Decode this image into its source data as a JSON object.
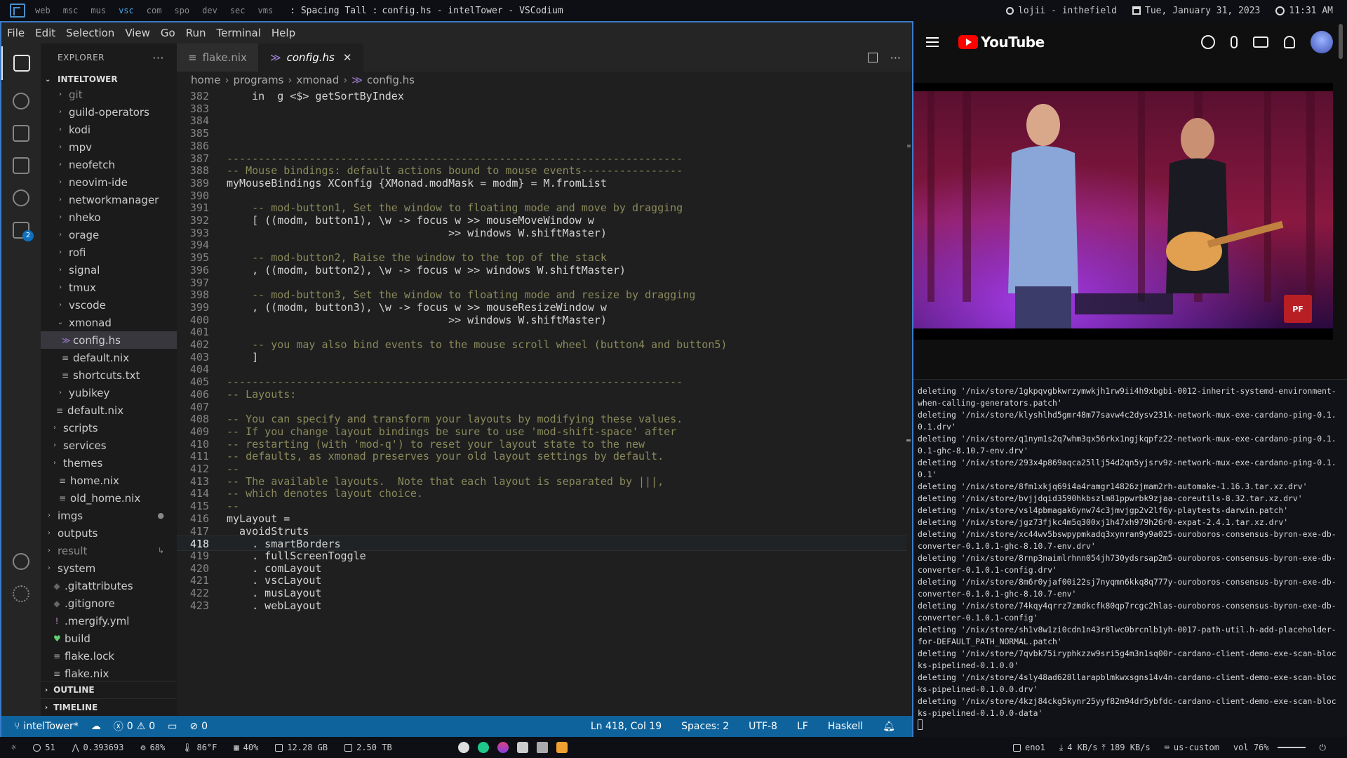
{
  "topbar": {
    "workspaces": [
      "web",
      "msc",
      "mus",
      "vsc",
      "com",
      "spo",
      "dev",
      "sec",
      "vms"
    ],
    "active_workspace": "vsc",
    "layout_name": "Spacing Tall",
    "window_title": "config.hs - intelTower - VSCodium",
    "user": "lojii - inthefield",
    "date": "Tue, January 31, 2023",
    "time": "11:31 AM"
  },
  "vscode": {
    "menu": [
      "File",
      "Edit",
      "Selection",
      "View",
      "Go",
      "Run",
      "Terminal",
      "Help"
    ],
    "explorer_title": "EXPLORER",
    "explorer_more": "···",
    "root": "INTELTOWER",
    "tree": [
      {
        "label": "git",
        "indent": 1,
        "kind": "folder",
        "dim": true
      },
      {
        "label": "guild-operators",
        "indent": 1,
        "kind": "folder"
      },
      {
        "label": "kodi",
        "indent": 1,
        "kind": "folder"
      },
      {
        "label": "mpv",
        "indent": 1,
        "kind": "folder"
      },
      {
        "label": "neofetch",
        "indent": 1,
        "kind": "folder"
      },
      {
        "label": "neovim-ide",
        "indent": 1,
        "kind": "folder"
      },
      {
        "label": "networkmanager",
        "indent": 1,
        "kind": "folder"
      },
      {
        "label": "nheko",
        "indent": 1,
        "kind": "folder"
      },
      {
        "label": "orage",
        "indent": 1,
        "kind": "folder"
      },
      {
        "label": "rofi",
        "indent": 1,
        "kind": "folder"
      },
      {
        "label": "signal",
        "indent": 1,
        "kind": "folder"
      },
      {
        "label": "tmux",
        "indent": 1,
        "kind": "folder"
      },
      {
        "label": "vscode",
        "indent": 1,
        "kind": "folder"
      },
      {
        "label": "xmonad",
        "indent": 1,
        "kind": "folder-open"
      },
      {
        "label": "config.hs",
        "indent": 2,
        "kind": "haskell",
        "selected": true
      },
      {
        "label": "default.nix",
        "indent": 2,
        "kind": "file"
      },
      {
        "label": "shortcuts.txt",
        "indent": 2,
        "kind": "file"
      },
      {
        "label": "yubikey",
        "indent": 1,
        "kind": "folder"
      },
      {
        "label": "default.nix",
        "indent": 1,
        "kind": "file"
      },
      {
        "label": "scripts",
        "indent": 0,
        "kind": "folder"
      },
      {
        "label": "services",
        "indent": 0,
        "kind": "folder"
      },
      {
        "label": "themes",
        "indent": 0,
        "kind": "folder"
      },
      {
        "label": "home.nix",
        "indent": 0,
        "kind": "file"
      },
      {
        "label": "old_home.nix",
        "indent": 0,
        "kind": "file"
      },
      {
        "label": "imgs",
        "indent": -1,
        "kind": "folder",
        "mark": "●"
      },
      {
        "label": "outputs",
        "indent": -1,
        "kind": "folder"
      },
      {
        "label": "result",
        "indent": -1,
        "kind": "folder",
        "dim": true,
        "mark": "↳"
      },
      {
        "label": "system",
        "indent": -1,
        "kind": "folder"
      },
      {
        "label": ".gitattributes",
        "indent": -1,
        "kind": "git"
      },
      {
        "label": ".gitignore",
        "indent": -1,
        "kind": "git"
      },
      {
        "label": ".mergify.yml",
        "indent": -1,
        "kind": "yml"
      },
      {
        "label": "build",
        "indent": -1,
        "kind": "heart"
      },
      {
        "label": "flake.lock",
        "indent": -1,
        "kind": "file"
      },
      {
        "label": "flake.nix",
        "indent": -1,
        "kind": "file"
      }
    ],
    "outline_label": "OUTLINE",
    "timeline_label": "TIMELINE",
    "tabs": [
      {
        "label": "flake.nix",
        "icon": "≡",
        "active": false
      },
      {
        "label": "config.hs",
        "icon": "≫",
        "active": true,
        "close": "✕"
      }
    ],
    "breadcrumb": [
      "home",
      "programs",
      "xmonad",
      "config.hs"
    ],
    "code_lines": [
      {
        "n": "382",
        "t": "    in  g <$> getSortByIndex"
      },
      {
        "n": "383",
        "t": ""
      },
      {
        "n": "384",
        "t": ""
      },
      {
        "n": "385",
        "t": ""
      },
      {
        "n": "386",
        "t": ""
      },
      {
        "n": "387",
        "t": "------------------------------------------------------------------------",
        "c": true
      },
      {
        "n": "388",
        "t": "-- Mouse bindings: default actions bound to mouse events----------------",
        "c": true
      },
      {
        "n": "389",
        "t": "myMouseBindings XConfig {XMonad.modMask = modm} = M.fromList"
      },
      {
        "n": "390",
        "t": ""
      },
      {
        "n": "391",
        "t": "    -- mod-button1, Set the window to floating mode and move by dragging",
        "c": true
      },
      {
        "n": "392",
        "t": "    [ ((modm, button1), \\w -> focus w >> mouseMoveWindow w"
      },
      {
        "n": "393",
        "t": "                                   >> windows W.shiftMaster)"
      },
      {
        "n": "394",
        "t": ""
      },
      {
        "n": "395",
        "t": "    -- mod-button2, Raise the window to the top of the stack",
        "c": true
      },
      {
        "n": "396",
        "t": "    , ((modm, button2), \\w -> focus w >> windows W.shiftMaster)"
      },
      {
        "n": "397",
        "t": ""
      },
      {
        "n": "398",
        "t": "    -- mod-button3, Set the window to floating mode and resize by dragging",
        "c": true
      },
      {
        "n": "399",
        "t": "    , ((modm, button3), \\w -> focus w >> mouseResizeWindow w"
      },
      {
        "n": "400",
        "t": "                                   >> windows W.shiftMaster)"
      },
      {
        "n": "401",
        "t": ""
      },
      {
        "n": "402",
        "t": "    -- you may also bind events to the mouse scroll wheel (button4 and button5)",
        "c": true
      },
      {
        "n": "403",
        "t": "    ]"
      },
      {
        "n": "404",
        "t": ""
      },
      {
        "n": "405",
        "t": "------------------------------------------------------------------------",
        "c": true
      },
      {
        "n": "406",
        "t": "-- Layouts:",
        "c": true
      },
      {
        "n": "407",
        "t": ""
      },
      {
        "n": "408",
        "t": "-- You can specify and transform your layouts by modifying these values.",
        "c": true
      },
      {
        "n": "409",
        "t": "-- If you change layout bindings be sure to use 'mod-shift-space' after",
        "c": true
      },
      {
        "n": "410",
        "t": "-- restarting (with 'mod-q') to reset your layout state to the new",
        "c": true
      },
      {
        "n": "411",
        "t": "-- defaults, as xmonad preserves your old layout settings by default.",
        "c": true
      },
      {
        "n": "412",
        "t": "--",
        "c": true
      },
      {
        "n": "413",
        "t": "-- The available layouts.  Note that each layout is separated by |||,",
        "c": true
      },
      {
        "n": "414",
        "t": "-- which denotes layout choice.",
        "c": true
      },
      {
        "n": "415",
        "t": "--",
        "c": true
      },
      {
        "n": "416",
        "t": "myLayout ="
      },
      {
        "n": "417",
        "t": "  avoidStruts"
      },
      {
        "n": "418",
        "t": "    . smartBorders",
        "cur": true
      },
      {
        "n": "419",
        "t": "    . fullScreenToggle"
      },
      {
        "n": "420",
        "t": "    . comLayout"
      },
      {
        "n": "421",
        "t": "    . vscLayout"
      },
      {
        "n": "422",
        "t": "    . musLayout"
      },
      {
        "n": "423",
        "t": "    . webLayout"
      }
    ],
    "status": {
      "branch": "intelTower*",
      "errors": "0",
      "warnings": "0",
      "ports": "0",
      "position": "Ln 418, Col 19",
      "spaces": "Spaces: 2",
      "encoding": "UTF-8",
      "eol": "LF",
      "language": "Haskell"
    }
  },
  "youtube": {
    "brand": "YouTube",
    "channel_badge": "PF"
  },
  "terminal": {
    "lines": [
      "deleting '/nix/store/1gkpqvgbkwrzymwkjh1rw9ii4h9xbgbi-0012-inherit-systemd-environment-when-calling-generators.patch'",
      "deleting '/nix/store/klyshlhd5gmr48m77savw4c2dysv231k-network-mux-exe-cardano-ping-0.1.0.1.drv'",
      "deleting '/nix/store/q1nym1s2q7whm3qx56rkx1ngjkqpfz22-network-mux-exe-cardano-ping-0.1.0.1-ghc-8.10.7-env.drv'",
      "deleting '/nix/store/293x4p869aqca25llj54d2qn5yjsrv9z-network-mux-exe-cardano-ping-0.1.0.1'",
      "deleting '/nix/store/8fm1xkjq69i4a4ramgr14826zjmam2rh-automake-1.16.3.tar.xz.drv'",
      "deleting '/nix/store/bvjjdqid3590hkbszlm81ppwrbk9zjaa-coreutils-8.32.tar.xz.drv'",
      "deleting '/nix/store/vsl4pbmagak6ynw74c3jmvjgp2v2lf6y-playtests-darwin.patch'",
      "deleting '/nix/store/jgz73fjkc4m5q300xj1h47xh979h26r0-expat-2.4.1.tar.xz.drv'",
      "deleting '/nix/store/xc44wv5bswpypmkadq3xynran9y9a025-ouroboros-consensus-byron-exe-db-converter-0.1.0.1-ghc-8.10.7-env.drv'",
      "deleting '/nix/store/8rnp3naimlrhnn054jh730ydsrsap2m5-ouroboros-consensus-byron-exe-db-converter-0.1.0.1-config.drv'",
      "deleting '/nix/store/8m6r0yjaf00i22sj7nyqmn6kkq8q777y-ouroboros-consensus-byron-exe-db-converter-0.1.0.1-ghc-8.10.7-env'",
      "deleting '/nix/store/74kqy4qrrz7zmdkcfk80qp7rcgc2hlas-ouroboros-consensus-byron-exe-db-converter-0.1.0.1-config'",
      "deleting '/nix/store/sh1v8w1zi0cdn1n43r8lwc0brcnlb1yh-0017-path-util.h-add-placeholder-for-DEFAULT_PATH_NORMAL.patch'",
      "deleting '/nix/store/7qvbk75iryphkzzw9sri5g4m3n1sq00r-cardano-client-demo-exe-scan-blocks-pipelined-0.1.0.0'",
      "deleting '/nix/store/4sly48ad628llarapblmkwxsgns14v4n-cardano-client-demo-exe-scan-blocks-pipelined-0.1.0.0.drv'",
      "deleting '/nix/store/4kzj84ckg5kynr25yyf82m94dr5ybfdc-cardano-client-demo-exe-scan-blocks-pipelined-0.1.0.0-data'"
    ]
  },
  "bottombar": {
    "updates": "51",
    "load": "0.393693",
    "cpu": "68%",
    "temp": "86°F",
    "mem_pct": "40%",
    "mem": "12.28 GB",
    "disk": "2.50 TB",
    "iface": "eno1",
    "down": "4 KB/s",
    "up": "189 KB/s",
    "keyboard": "us-custom",
    "volume": "vol 76%"
  }
}
